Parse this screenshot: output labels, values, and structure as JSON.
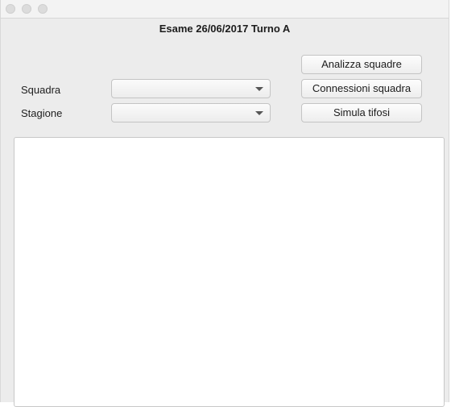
{
  "window": {
    "heading": "Esame 26/06/2017 Turno A"
  },
  "form": {
    "squadra_label": "Squadra",
    "squadra_value": "",
    "stagione_label": "Stagione",
    "stagione_value": ""
  },
  "buttons": {
    "analizza": "Analizza squadre",
    "connessioni": "Connessioni squadra",
    "simula": "Simula tifosi"
  },
  "output": {
    "text": ""
  }
}
